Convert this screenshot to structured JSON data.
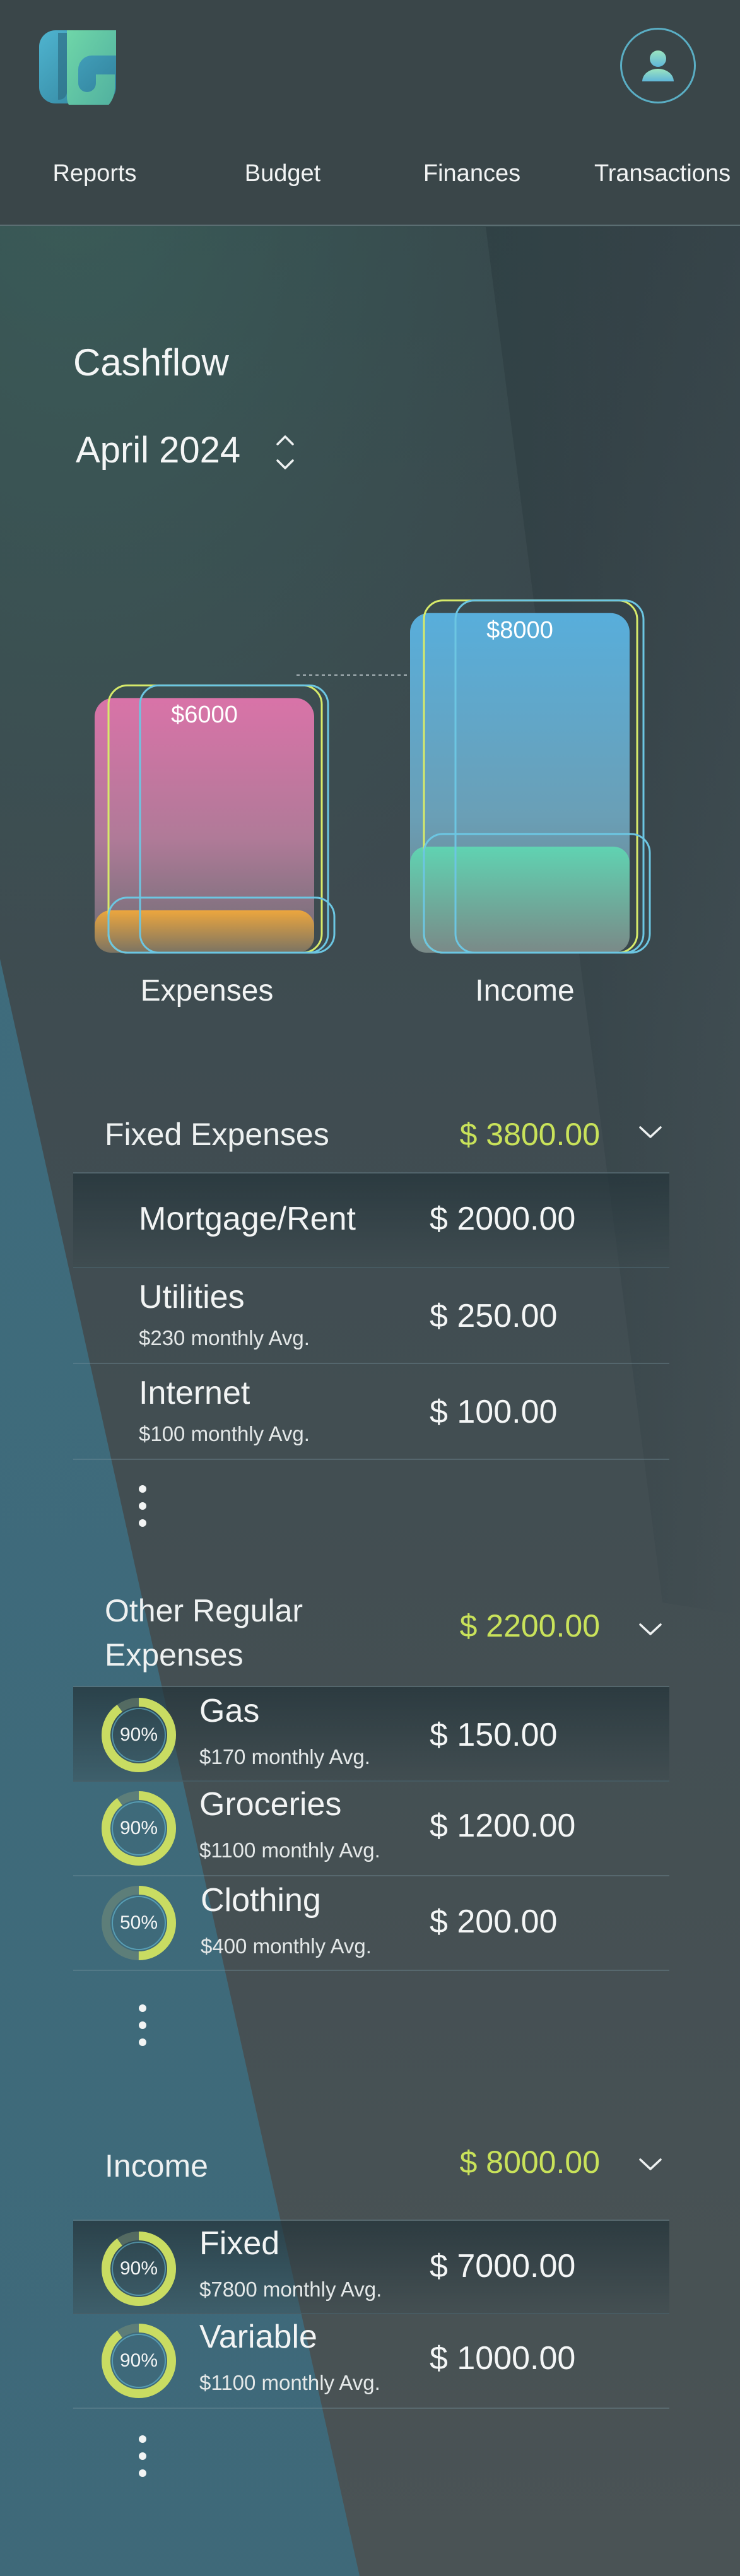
{
  "nav": {
    "items": [
      "Reports",
      "Budget",
      "Finances",
      "Transactions"
    ]
  },
  "icons": {
    "logo": "app-logo-icon",
    "profile": "user-icon",
    "month_stepper": "up-down-chevron-icon",
    "expand": "chevron-down-icon",
    "more": "vertical-ellipsis-icon"
  },
  "colors": {
    "accent_total": "#c9e25a",
    "expenses_bar": "#d77aaa",
    "expenses_fill": "#f0a93a",
    "income_bar": "#5bb0d8",
    "income_fill": "#5fd4b0",
    "ring_outline_green": "#d7ea6a",
    "ring_outline_blue": "#6cc6e2"
  },
  "cashflow": {
    "title": "Cashflow",
    "month": "April 2024"
  },
  "chart_data": {
    "type": "bar",
    "categories": [
      "Expenses",
      "Income"
    ],
    "values": [
      6000,
      8000
    ],
    "value_labels": [
      "$6000",
      "$8000"
    ],
    "inner_values": [
      1000,
      2500
    ],
    "ylim": [
      0,
      8000
    ]
  },
  "fixed_expenses": {
    "title": "Fixed Expenses",
    "total": "$  3800.00",
    "items": [
      {
        "name": "Mortgage/Rent",
        "sub": "",
        "amount": "$ 2000.00"
      },
      {
        "name": "Utilities",
        "sub": "$230 monthly Avg.",
        "amount": "$ 250.00"
      },
      {
        "name": "Internet",
        "sub": "$100 monthly Avg.",
        "amount": "$ 100.00"
      }
    ]
  },
  "other_expenses": {
    "title_line1": "Other Regular",
    "title_line2": "Expenses",
    "total": "$  2200.00",
    "items": [
      {
        "name": "Gas",
        "sub": "$170 monthly Avg.",
        "amount": "$ 150.00",
        "pct_label": "90%",
        "pct": 0.9
      },
      {
        "name": "Groceries",
        "sub": "$1100 monthly Avg.",
        "amount": "$ 1200.00",
        "pct_label": "90%",
        "pct": 0.9
      },
      {
        "name": "Clothing",
        "sub": "$400 monthly Avg.",
        "amount": "$ 200.00",
        "pct_label": "50%",
        "pct": 0.5
      }
    ]
  },
  "income": {
    "title": "Income",
    "total": "$  8000.00",
    "items": [
      {
        "name": "Fixed",
        "sub": "$7800 monthly Avg.",
        "amount": "$ 7000.00",
        "pct_label": "90%",
        "pct": 0.9
      },
      {
        "name": "Variable",
        "sub": "$1100 monthly Avg.",
        "amount": "$ 1000.00",
        "pct_label": "90%",
        "pct": 0.9
      }
    ]
  }
}
